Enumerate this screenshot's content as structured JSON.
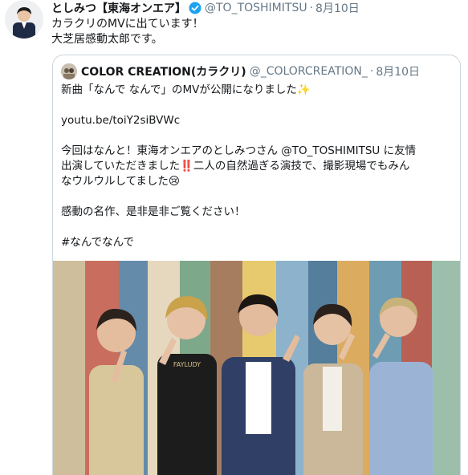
{
  "tweet": {
    "display_name": "としみつ【東海オンエア】",
    "handle": "@TO_TOSHIMITSU",
    "separator": "·",
    "time": "8月10日",
    "text_line1": "カラクリのMVに出ています！",
    "text_line2": "大芝居感動太郎です。",
    "icons": [
      "avatar",
      "verified-badge-icon"
    ]
  },
  "quoted": {
    "display_name": "COLOR CREATION(カラクリ)",
    "handle": "@_COLORCREATION_",
    "separator": "·",
    "time": "8月10日",
    "line1": "新曲「なんで なんで」のMVが公開になりました✨",
    "link": "youtu.be/toiY2siBVWc",
    "line3": "今回はなんと！東海オンエアのとしみつさん @TO_TOSHIMITSU に友情",
    "line4": "出演していただきました‼️二人の自然過ぎる演技で、撮影現場でもみん",
    "line5": "なウルウルしてました😢",
    "line6": "感動の名作、是非是非ご覧ください！",
    "hashtag": "#なんでなんで",
    "media": {
      "shirt_text": "FAYLUDY",
      "colors": {
        "wall_stripes": [
          "#c9b58f",
          "#c25b48",
          "#4f7c9f",
          "#e5c35a",
          "#7ea8c4",
          "#9b6b4b",
          "#5a8fa8",
          "#d7a04a",
          "#3e6c8f",
          "#e2d3b5",
          "#b04a3e",
          "#6d9c7a"
        ]
      }
    }
  },
  "colors": {
    "text": "#14171a",
    "muted": "#657786",
    "verified": "#1da1f2",
    "border": "#ccd6dd"
  }
}
